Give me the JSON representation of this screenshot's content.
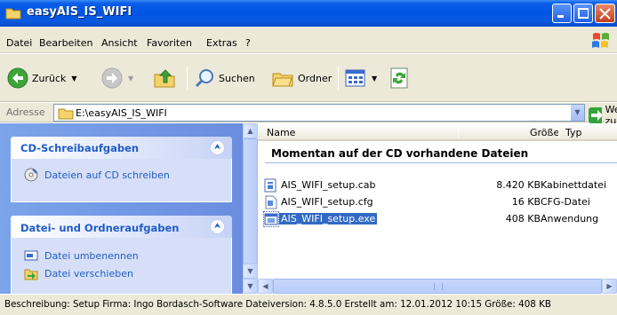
{
  "window": {
    "title": "easyAIS_IS_WIFI"
  },
  "menu": [
    "Datei",
    "Bearbeiten",
    "Ansicht",
    "Favoriten",
    "Extras",
    "?"
  ],
  "toolbar": {
    "back_label": "Zurück",
    "search_label": "Suchen",
    "folders_label": "Ordner"
  },
  "address": {
    "label": "Adresse",
    "value": "E:\\easyAIS_IS_WIFI",
    "go_label": "Wechseln zu"
  },
  "left_pane": {
    "cd_tasks": {
      "title": "CD-Schreibaufgaben",
      "items": [
        "Dateien auf CD schreiben"
      ]
    },
    "file_tasks": {
      "title": "Datei- und Ordneraufgaben",
      "items": [
        "Datei umbenennen",
        "Datei verschieben"
      ]
    }
  },
  "list": {
    "columns": [
      "Name",
      "Größe",
      "Typ"
    ],
    "group_header": "Momentan auf der CD vorhandene Dateien",
    "files": [
      {
        "name": "AIS_WIFI_setup.cab",
        "size": "8.420 KB",
        "type": "Kabinettdatei",
        "icon": "cab-file-icon",
        "selected": false
      },
      {
        "name": "AIS_WIFI_setup.cfg",
        "size": "16 KB",
        "type": "CFG-Datei",
        "icon": "cfg-file-icon",
        "selected": false
      },
      {
        "name": "AIS_WIFI_setup.exe",
        "size": "408 KB",
        "type": "Anwendung",
        "icon": "exe-file-icon",
        "selected": true
      }
    ]
  },
  "status": {
    "text": "Beschreibung: Setup Firma: Ingo Bordasch-Software Dateiversion: 4.8.5.0 Erstellt am: 12.01.2012 10:15 Größe: 408 KB"
  },
  "colors": {
    "titlebar": "#0054e3",
    "task_pane": "#6b8ddf",
    "task_link": "#215dc6",
    "selection": "#316ac5"
  }
}
